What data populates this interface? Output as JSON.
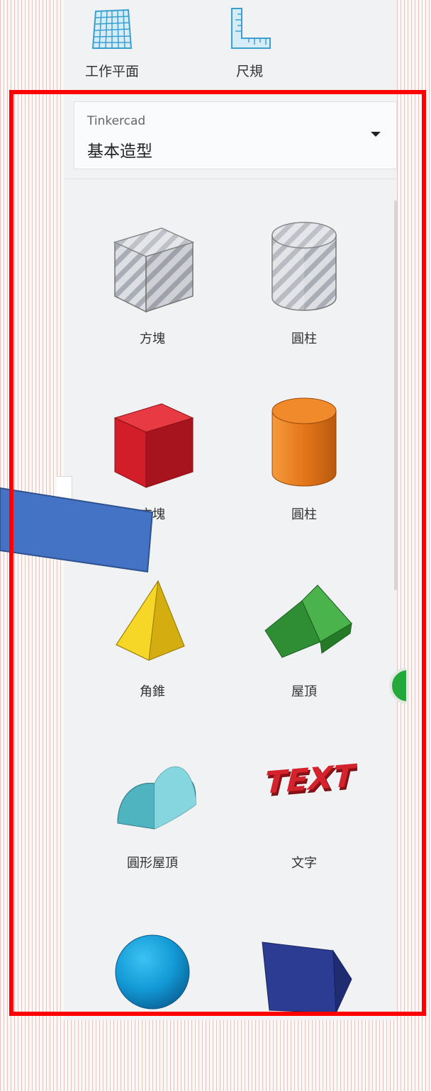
{
  "toolbar": {
    "workplane_label": "工作平面",
    "ruler_label": "尺規"
  },
  "library": {
    "source": "Tinkercad",
    "category": "基本造型"
  },
  "shapes": [
    {
      "label": "方塊",
      "icon": "box-hole-icon"
    },
    {
      "label": "圓柱",
      "icon": "cylinder-hole-icon"
    },
    {
      "label": "方塊",
      "icon": "box-icon"
    },
    {
      "label": "圓柱",
      "icon": "cylinder-icon"
    },
    {
      "label": "角錐",
      "icon": "pyramid-icon"
    },
    {
      "label": "屋頂",
      "icon": "roof-icon"
    },
    {
      "label": "圓形屋頂",
      "icon": "round-roof-icon"
    },
    {
      "label": "文字",
      "icon": "text-icon"
    },
    {
      "label": "",
      "icon": "sphere-icon"
    },
    {
      "label": "",
      "icon": "polygon-icon"
    }
  ],
  "collapse_glyph": "›",
  "colors": {
    "frame": "#ff0000",
    "box": "#d4202a",
    "cylinder": "#e9781b",
    "pyramid": "#f2cf1d",
    "roof": "#3aa53c",
    "round_roof": "#6ec7d1",
    "text": "#d2232e",
    "sphere": "#1ba0d8",
    "polygon": "#2b3a8f",
    "arrow": "#4472c4"
  }
}
